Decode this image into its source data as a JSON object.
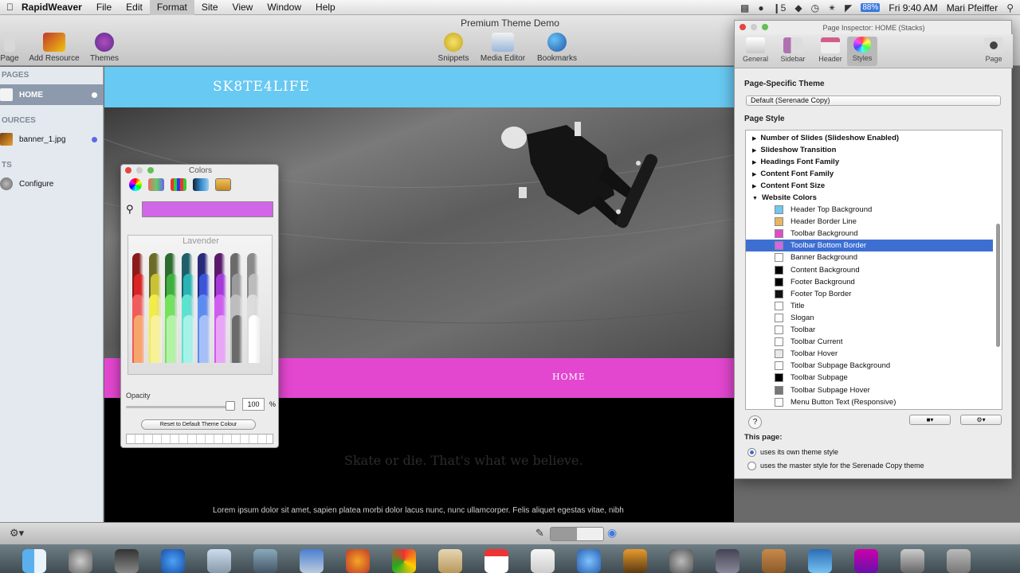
{
  "menubar": {
    "app": "RapidWeaver",
    "items": [
      "File",
      "Edit",
      "Format",
      "Site",
      "View",
      "Window",
      "Help"
    ],
    "battery": "88%",
    "clock": "Fri 9:40 AM",
    "user": "Mari Pfeiffer",
    "status_icon_text": "5"
  },
  "window": {
    "title": "Premium Theme Demo"
  },
  "toolbar": {
    "left": [
      "Page",
      "Add Resource",
      "Themes"
    ],
    "center": [
      "Snippets",
      "Media Editor",
      "Bookmarks"
    ]
  },
  "sidebar": {
    "pages_header": "PAGES",
    "home": "HOME",
    "resources_header": "OURCES",
    "resource_file": "banner_1.jpg",
    "sets_header": "TS",
    "configure": "Configure"
  },
  "site": {
    "brand": "SK8TE4LIFE",
    "nav_home": "HOME",
    "slogan": "Skate or die. That's what we believe.",
    "lorem": "Lorem ipsum dolor sit amet, sapien platea morbi dolor lacus nunc, nunc ullamcorper. Felis aliquet egestas vitae, nibh"
  },
  "colors_panel": {
    "title": "Colors",
    "crayon_name": "Lavender",
    "opacity_label": "Opacity",
    "opacity_value": "100",
    "pct": "%",
    "reset_label": "Reset to Default Theme Colour",
    "selected_color": "#d266e8"
  },
  "inspector": {
    "title": "Page Inspector: HOME (Stacks)",
    "tabs": [
      "General",
      "Sidebar",
      "Header",
      "Styles",
      "Page"
    ],
    "theme_label": "Page-Specific Theme",
    "theme_value": "Default (Serenade Copy)",
    "style_label": "Page Style",
    "groups": [
      "Number of Slides (Slideshow Enabled)",
      "Slideshow Transition",
      "Headings Font Family",
      "Content Font Family",
      "Content Font Size",
      "Website Colors"
    ],
    "colors": [
      {
        "name": "Header Top Background",
        "color": "#6ec8f0"
      },
      {
        "name": "Header Border Line",
        "color": "#e8b562"
      },
      {
        "name": "Toolbar Background",
        "color": "#e04cc8"
      },
      {
        "name": "Toolbar Bottom Border",
        "color": "#d266e8"
      },
      {
        "name": "Banner Background",
        "color": "#ffffff"
      },
      {
        "name": "Content Background",
        "color": "#000000"
      },
      {
        "name": "Footer Background",
        "color": "#000000"
      },
      {
        "name": "Footer Top Border",
        "color": "#111111"
      },
      {
        "name": "Title",
        "color": "#ffffff"
      },
      {
        "name": "Slogan",
        "color": "#ffffff"
      },
      {
        "name": "Toolbar",
        "color": "#ffffff"
      },
      {
        "name": "Toolbar Current",
        "color": "#ffffff"
      },
      {
        "name": "Toolbar Hover",
        "color": "#e8e8e8"
      },
      {
        "name": "Toolbar Subpage Background",
        "color": "#ffffff"
      },
      {
        "name": "Toolbar Subpage",
        "color": "#000000"
      },
      {
        "name": "Toolbar Subpage Hover",
        "color": "#777777"
      },
      {
        "name": "Menu Button Text (Responsive)",
        "color": "#ffffff"
      }
    ],
    "this_page_label": "This page:",
    "radio_own": "uses its own theme style",
    "radio_master": "uses the master style for the Serenade Copy theme",
    "help": "?"
  }
}
